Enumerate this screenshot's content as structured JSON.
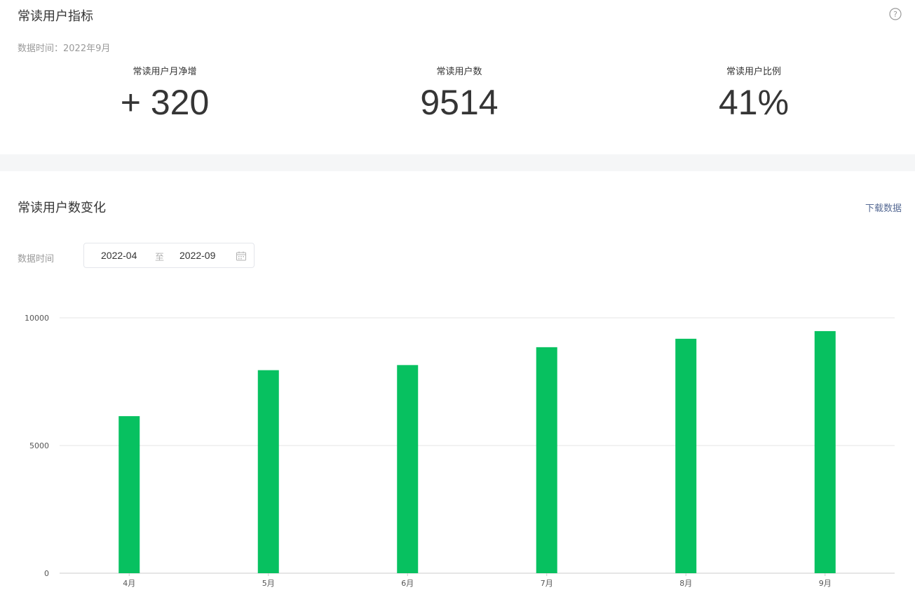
{
  "top": {
    "title": "常读用户指标",
    "data_time": "数据时间：2022年9月",
    "metrics": [
      {
        "label": "常读用户月净增",
        "value": "+ 320"
      },
      {
        "label": "常读用户数",
        "value": "9514"
      },
      {
        "label": "常读用户比例",
        "value": "41%"
      }
    ],
    "help_icon": "question-circle-icon"
  },
  "trend": {
    "title": "常读用户数变化",
    "download_label": "下载数据",
    "filter_label": "数据时间",
    "date_start": "2022-04",
    "date_separator": "至",
    "date_end": "2022-09",
    "calendar_icon": "calendar-icon"
  },
  "colors": {
    "bar": "#07c160",
    "grid": "#e5e5e5",
    "link": "#576b95",
    "band": "#f5f6f7"
  },
  "chart_data": {
    "type": "bar",
    "categories": [
      "4月",
      "5月",
      "6月",
      "7月",
      "8月",
      "9月"
    ],
    "values": [
      6150,
      7950,
      8150,
      8850,
      9180,
      9480
    ],
    "ylim": [
      0,
      10000
    ],
    "yticks": [
      0,
      5000,
      10000
    ],
    "grid": true,
    "legend": "none"
  }
}
